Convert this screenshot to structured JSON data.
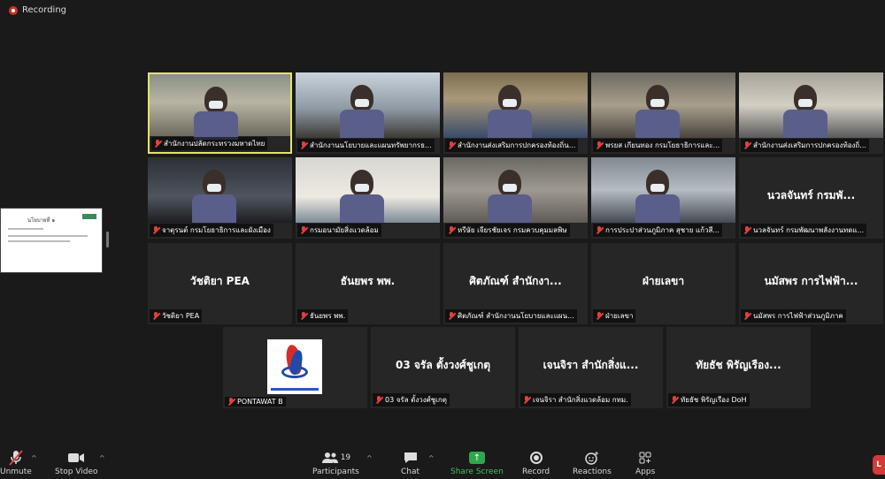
{
  "recording": {
    "label": "Recording"
  },
  "shared_screen": {
    "title": "นโยบายที่ ๑"
  },
  "tiles_row1": [
    {
      "label": "สำนักงานปลัดกระทรวงมหาดไทย",
      "video": "v-office",
      "active": true
    },
    {
      "label": "สำนักงานนโยบายและแผนทรัพยากรธ...",
      "video": "v-window"
    },
    {
      "label": "สำนักงานส่งเสริมการปกครองท้องถิ่น...",
      "video": "v-meeting"
    },
    {
      "label": "พรยส เกียนทอง กรมโยธาธิการและ...",
      "video": "v-closeup"
    },
    {
      "label": "สำนักงานส่งเสริมการปกครองท้องถิ่...",
      "video": "v-room"
    }
  ],
  "tiles_row2": [
    {
      "label": "จาตุรนต์ กรมโยธาธิการและผังเมือง",
      "video": "v-dark"
    },
    {
      "label": "กรมอนามัยสิ่งแวดล้อม",
      "video": "v-white"
    },
    {
      "label": "หรีษัย เจียรชัยเจร กรมควบคุมมลพิษ",
      "video": "v-blur"
    },
    {
      "label": "การประปาส่วนภูมิภาค สุชาย แก้วสี...",
      "video": "v-grey"
    },
    {
      "label": "นวลจันทร์ กรมพัฒนาพลังงานทดแ...",
      "name": "นวลจันทร์ กรมพั..."
    }
  ],
  "tiles_row3": [
    {
      "label": "วัชติยา PEA",
      "name": "วัชติยา PEA"
    },
    {
      "label": "ธันยพร พพ.",
      "name": "ธันยพร พพ."
    },
    {
      "label": "ศิตภัณฑ์ สำนักงานนโยบายและแผน...",
      "name": "ศิตภัณฑ์ สำนักงา..."
    },
    {
      "label": "ฝ่ายเลขา",
      "name": "ฝ่ายเลขา"
    },
    {
      "label": "นมัสพร การไฟฟ้าส่วนภูมิภาค",
      "name": "นมัสพร การไฟฟ้า..."
    }
  ],
  "tiles_row4": [
    {
      "label": "PONTAWAT B",
      "logo": true
    },
    {
      "label": "03 จรัล ตั้งวงศ์ชูเกตุ",
      "name": "03 จรัล ตั้งวงศ์ชูเกตุ"
    },
    {
      "label": "เจนจิรา สำนักสิ่งแวดล้อม กทม.",
      "name": "เจนจิรา สำนักสิ่งแ..."
    },
    {
      "label": "ทัยธัช พิรัญเรือง DoH",
      "name": "ทัยธัช พิรัญเรือง..."
    }
  ],
  "toolbar": {
    "unmute": "Unmute",
    "stop_video": "Stop Video",
    "participants": "Participants",
    "participants_count": "19",
    "chat": "Chat",
    "share_screen": "Share Screen",
    "record": "Record",
    "reactions": "Reactions",
    "apps": "Apps",
    "leave": "L"
  }
}
